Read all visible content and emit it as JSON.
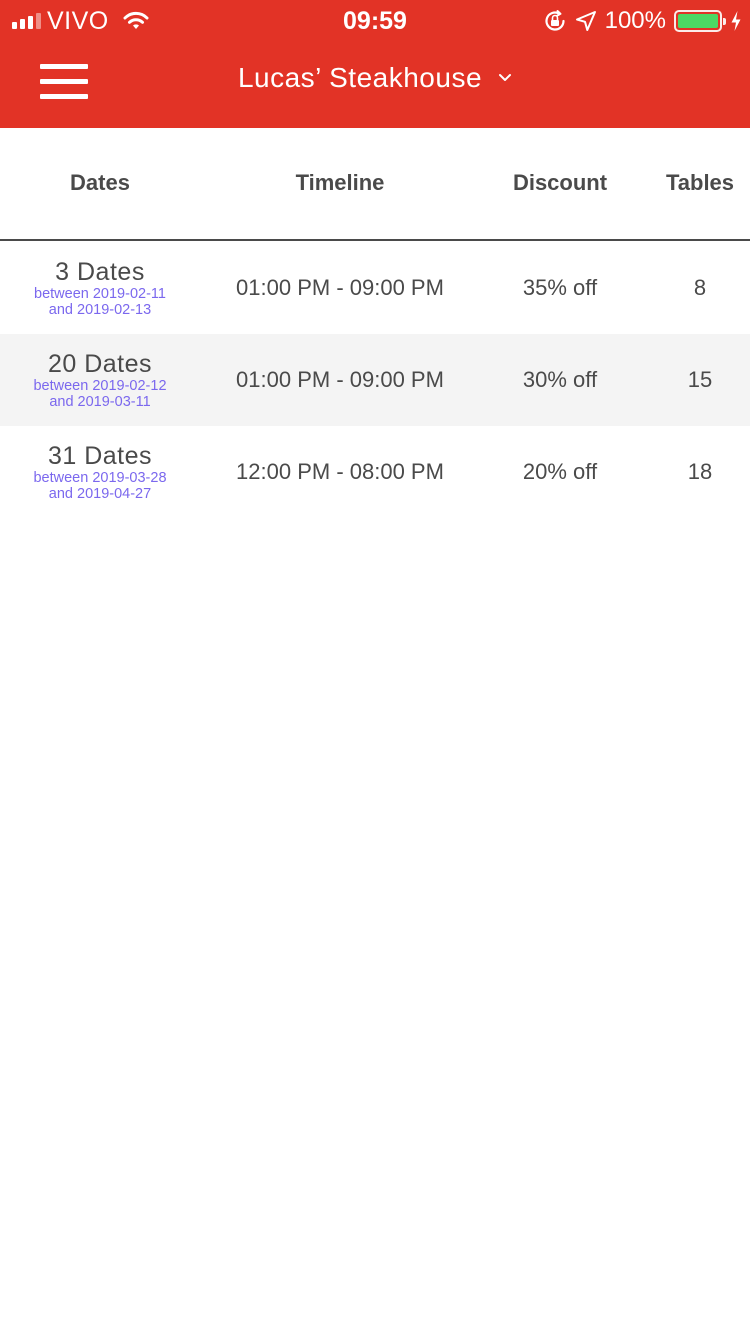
{
  "status_bar": {
    "carrier": "VIVO",
    "time": "09:59",
    "battery": "100%"
  },
  "nav": {
    "title": "Lucas’ Steakhouse"
  },
  "table": {
    "headers": {
      "dates": "Dates",
      "timeline": "Timeline",
      "discount": "Discount",
      "tables": "Tables"
    },
    "rows": [
      {
        "count": "3 Dates",
        "range_start": "between 2019-02-11",
        "range_end": "and 2019-02-13",
        "timeline": "01:00 PM - 09:00 PM",
        "discount": "35% off",
        "tables": "8"
      },
      {
        "count": "20 Dates",
        "range_start": "between 2019-02-12",
        "range_end": "and 2019-03-11",
        "timeline": "01:00 PM - 09:00 PM",
        "discount": "30% off",
        "tables": "15"
      },
      {
        "count": "31 Dates",
        "range_start": "between 2019-03-28",
        "range_end": "and 2019-04-27",
        "timeline": "12:00 PM - 08:00 PM",
        "discount": "20% off",
        "tables": "18"
      }
    ]
  },
  "colors": {
    "brand": "#e23326",
    "date_range": "#7b68ee",
    "row_alt": "#f4f4f4",
    "battery": "#4cd964"
  },
  "icons": [
    "signal-icon",
    "wifi-icon",
    "orientation-lock-icon",
    "location-icon",
    "battery-icon",
    "charging-icon",
    "menu-icon",
    "chevron-down-icon"
  ]
}
